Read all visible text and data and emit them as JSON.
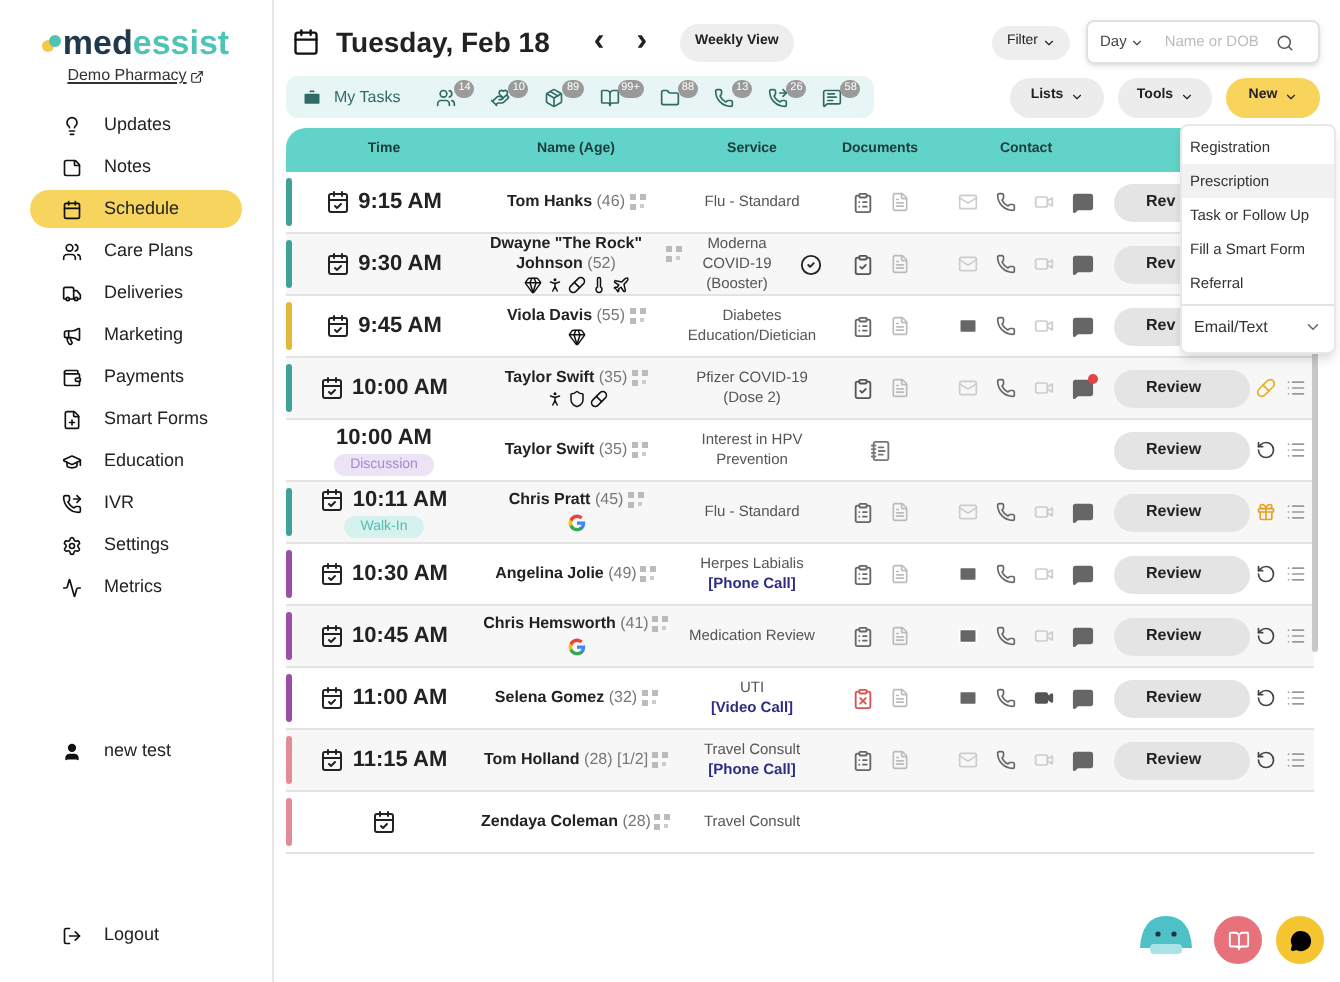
{
  "brand": {
    "name_a": "med",
    "name_b": "essist",
    "pharmacy": "Demo Pharmacy"
  },
  "nav": [
    {
      "label": "Updates",
      "selected": false
    },
    {
      "label": "Notes",
      "selected": false
    },
    {
      "label": "Schedule",
      "selected": true
    },
    {
      "label": "Care Plans",
      "selected": false
    },
    {
      "label": "Deliveries",
      "selected": false
    },
    {
      "label": "Marketing",
      "selected": false
    },
    {
      "label": "Payments",
      "selected": false
    },
    {
      "label": "Smart Forms",
      "selected": false
    },
    {
      "label": "Education",
      "selected": false
    },
    {
      "label": "IVR",
      "selected": false
    },
    {
      "label": "Settings",
      "selected": false
    },
    {
      "label": "Metrics",
      "selected": false
    }
  ],
  "user": {
    "label": "new test"
  },
  "logout": "Logout",
  "header": {
    "date": "Tuesday, Feb 18",
    "prev": "‹",
    "next": "›",
    "weekly": "Weekly View",
    "filter": "Filter",
    "day": "Day",
    "search_placeholder": "Name or DOB"
  },
  "tasks": {
    "label": "My Tasks",
    "items": [
      {
        "count": "14"
      },
      {
        "count": "10"
      },
      {
        "count": "89"
      },
      {
        "count": "99+"
      },
      {
        "count": "88"
      },
      {
        "count": "13"
      },
      {
        "count": "26"
      },
      {
        "count": "58"
      }
    ]
  },
  "actions": [
    {
      "label": "Lists",
      "kind": "plain"
    },
    {
      "label": "Tools",
      "kind": "plain"
    },
    {
      "label": "New",
      "kind": "primary"
    }
  ],
  "columns": [
    "Time",
    "Name (Age)",
    "Service",
    "Documents",
    "Contact"
  ],
  "rows": [
    {
      "color": "#3fa19a",
      "time": "9:15 AM",
      "calendar_icon": true,
      "name": "Tom Hanks",
      "age": "(46)",
      "service": "Flu - Standard",
      "documents": {
        "kind": "search"
      },
      "contact": {
        "unread": false,
        "video": false,
        "chat_alert": false
      },
      "review": "Rev"
    },
    {
      "color": "#3fa19a",
      "time": "9:30 AM",
      "calendar_icon": true,
      "name": "Dwayne \"The Rock\" Johnson",
      "age": "(52)",
      "badges": [
        {
          "kind": "gem"
        },
        {
          "kind": "walk"
        },
        {
          "kind": "bottle"
        },
        {
          "kind": "thermo"
        },
        {
          "kind": "plane"
        }
      ],
      "service": "Moderna COVID-19 (Booster)",
      "verified": true,
      "documents": {
        "kind": "checked"
      },
      "contact": {
        "unread": false,
        "video": false,
        "chat_alert": false
      },
      "review": "Rev"
    },
    {
      "color": "#e2b73c",
      "time": "9:45 AM",
      "calendar_icon": true,
      "name": "Viola Davis",
      "age": "(55)",
      "badges": [
        {
          "kind": "gem"
        }
      ],
      "service": "Diabetes Education/Dietician",
      "documents": {
        "kind": "search"
      },
      "contact": {
        "unread": true,
        "video": false,
        "chat_alert": false
      },
      "review": "Rev"
    },
    {
      "color": "#3fa19a",
      "time": "10:00 AM",
      "calendar_icon": true,
      "name": "Taylor Swift",
      "age": "(35)",
      "badges": [
        {
          "kind": "walk"
        },
        {
          "kind": "shield"
        },
        {
          "kind": "bottle"
        }
      ],
      "service": "Pfizer COVID-19 (Dose 2)",
      "documents": {
        "kind": "checked"
      },
      "contact": {
        "unread": false,
        "video": false,
        "chat_alert": true
      },
      "review": "Review",
      "action": {
        "kind": "bottle"
      }
    },
    {
      "time": "10:00 AM",
      "calendar_icon": false,
      "tag": {
        "label": "Discussion",
        "kind": "discussion"
      },
      "name": "Taylor Swift",
      "age": "(35)",
      "service": "Interest in HPV Prevention",
      "documents": {
        "kind": "book"
      },
      "review": "Review",
      "action": {
        "kind": "undo"
      }
    },
    {
      "color": "#3fa19a",
      "time": "10:11 AM",
      "calendar_icon": true,
      "tag": {
        "label": "Walk-In",
        "kind": "walkin"
      },
      "name": "Chris Pratt",
      "age": "(45)",
      "badges": [
        {
          "kind": "google"
        }
      ],
      "service": "Flu - Standard",
      "documents": {
        "kind": "search"
      },
      "contact": {
        "unread": false,
        "video": false,
        "chat_alert": false
      },
      "review": "Review",
      "action": {
        "kind": "box"
      }
    },
    {
      "color": "#9a4ea6",
      "time": "10:30 AM",
      "calendar_icon": true,
      "name": "Angelina Jolie",
      "age": "(49)",
      "service": "Herpes Labialis",
      "call": "[Phone Call]",
      "documents": {
        "kind": "search"
      },
      "contact": {
        "unread": true,
        "video": false,
        "chat_alert": false
      },
      "review": "Review",
      "action": {
        "kind": "undo"
      }
    },
    {
      "color": "#9a4ea6",
      "time": "10:45 AM",
      "calendar_icon": true,
      "name": "Chris Hemsworth",
      "age": "(41)",
      "badges": [
        {
          "kind": "google"
        }
      ],
      "service": "Medication Review",
      "documents": {
        "kind": "search"
      },
      "contact": {
        "unread": true,
        "video": false,
        "chat_alert": false
      },
      "review": "Review",
      "action": {
        "kind": "undo"
      }
    },
    {
      "color": "#9a4ea6",
      "time": "11:00 AM",
      "calendar_icon": true,
      "name": "Selena Gomez",
      "age": "(32)",
      "service": "UTI",
      "call": "[Video Call]",
      "documents": {
        "kind": "alert"
      },
      "contact": {
        "unread": true,
        "video": true,
        "chat_alert": false
      },
      "review": "Review",
      "action": {
        "kind": "undo"
      }
    },
    {
      "color": "#e58b95",
      "time": "11:15 AM",
      "calendar_icon": true,
      "name": "Tom Holland",
      "age": "(28) [1/2]",
      "service": "Travel Consult",
      "call": "[Phone Call]",
      "documents": {
        "kind": "search"
      },
      "contact": {
        "unread": false,
        "video": false,
        "chat_alert": false
      },
      "review": "Review",
      "action": {
        "kind": "undo"
      }
    },
    {
      "color": "#e58b95",
      "calendar_icon": true,
      "name": "Zendaya Coleman",
      "age": "(28)",
      "service": "Travel Consult"
    }
  ],
  "menu": [
    {
      "label": "Registration",
      "selected": false
    },
    {
      "label": "Prescription",
      "selected": true
    },
    {
      "label": "Task or Follow Up",
      "selected": false
    },
    {
      "label": "Fill a Smart Form",
      "selected": false
    },
    {
      "label": "Referral",
      "selected": false
    }
  ],
  "menu_footer": "Email/Text"
}
